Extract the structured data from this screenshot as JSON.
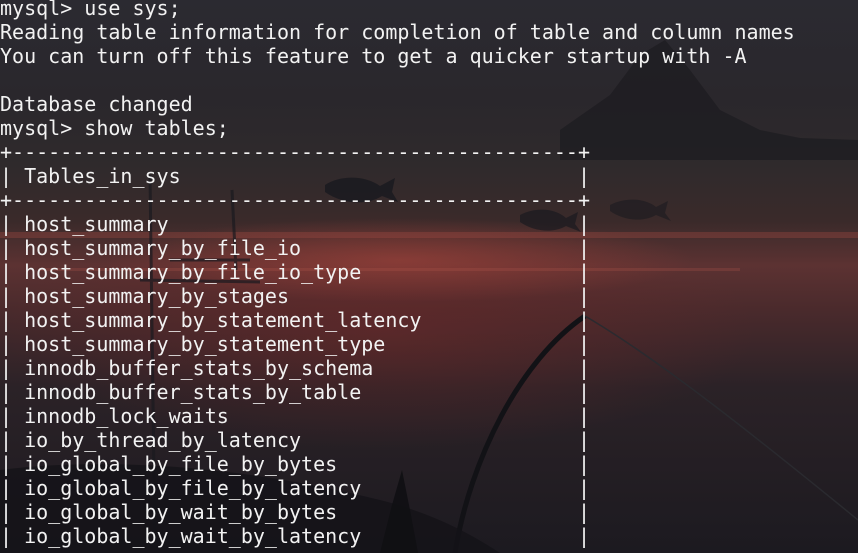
{
  "terminal": {
    "lines": [
      "mysql> use sys;",
      "Reading table information for completion of table and column names",
      "You can turn off this feature to get a quicker startup with -A",
      "",
      "Database changed",
      "mysql> show tables;",
      "+-----------------------------------------------+",
      "| Tables_in_sys                                 |",
      "+-----------------------------------------------+",
      "| host_summary                                  |",
      "| host_summary_by_file_io                       |",
      "| host_summary_by_file_io_type                  |",
      "| host_summary_by_stages                        |",
      "| host_summary_by_statement_latency             |",
      "| host_summary_by_statement_type                |",
      "| innodb_buffer_stats_by_schema                 |",
      "| innodb_buffer_stats_by_table                  |",
      "| innodb_lock_waits                             |",
      "| io_by_thread_by_latency                       |",
      "| io_global_by_file_by_bytes                    |",
      "| io_global_by_file_by_latency                  |",
      "| io_global_by_wait_by_bytes                    |",
      "| io_global_by_wait_by_latency                  |"
    ]
  },
  "colors": {
    "text": "#f2f2f2",
    "background": "#1b1b22",
    "sunset_accent": "#8a3b36"
  }
}
